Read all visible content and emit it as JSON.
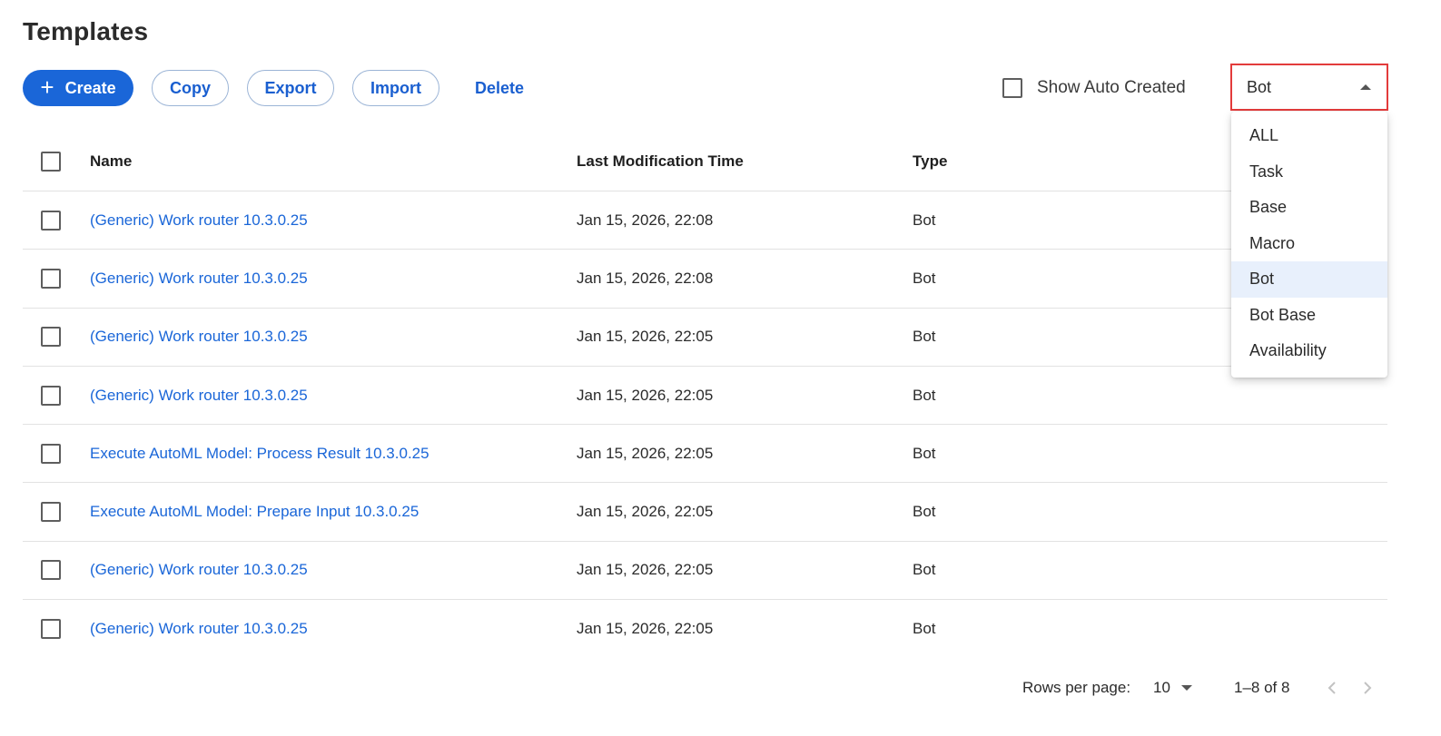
{
  "page": {
    "title": "Templates"
  },
  "toolbar": {
    "create_label": "Create",
    "copy_label": "Copy",
    "export_label": "Export",
    "import_label": "Import",
    "delete_label": "Delete"
  },
  "filters": {
    "show_auto_created_label": "Show Auto Created",
    "show_auto_created_checked": false,
    "type_select": {
      "value": "Bot",
      "expanded": true,
      "options": [
        "ALL",
        "Task",
        "Base",
        "Macro",
        "Bot",
        "Bot Base",
        "Availability"
      ],
      "selected_option": "Bot"
    }
  },
  "table": {
    "columns": {
      "name": "Name",
      "time": "Last Modification Time",
      "type": "Type"
    },
    "rows": [
      {
        "name": "(Generic) Work router 10.3.0.25",
        "time": "Jan 15, 2026, 22:08",
        "type": "Bot"
      },
      {
        "name": "(Generic) Work router 10.3.0.25",
        "time": "Jan 15, 2026, 22:08",
        "type": "Bot"
      },
      {
        "name": "(Generic) Work router 10.3.0.25",
        "time": "Jan 15, 2026, 22:05",
        "type": "Bot"
      },
      {
        "name": "(Generic) Work router 10.3.0.25",
        "time": "Jan 15, 2026, 22:05",
        "type": "Bot"
      },
      {
        "name": "Execute AutoML Model: Process Result 10.3.0.25",
        "time": "Jan 15, 2026, 22:05",
        "type": "Bot"
      },
      {
        "name": "Execute AutoML Model: Prepare Input 10.3.0.25",
        "time": "Jan 15, 2026, 22:05",
        "type": "Bot"
      },
      {
        "name": "(Generic) Work router 10.3.0.25",
        "time": "Jan 15, 2026, 22:05",
        "type": "Bot"
      },
      {
        "name": "(Generic) Work router 10.3.0.25",
        "time": "Jan 15, 2026, 22:05",
        "type": "Bot"
      }
    ]
  },
  "pagination": {
    "rows_per_page_label": "Rows per page:",
    "rows_per_page_value": "10",
    "range_text": "1–8 of 8",
    "prev_icon": "chevron-left-icon",
    "next_icon": "chevron-right-icon"
  },
  "colors": {
    "primary": "#1a66d8",
    "link": "#1a66d8",
    "highlight_border": "#e33b3b",
    "selected_option_bg": "#e8f0fc"
  }
}
